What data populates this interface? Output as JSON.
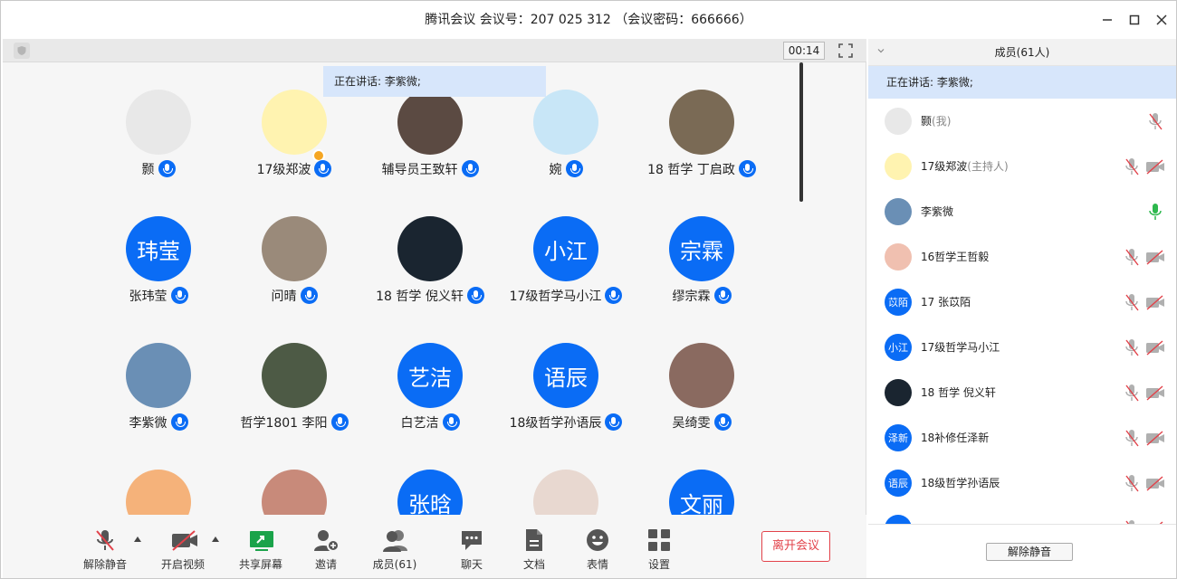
{
  "window": {
    "title": "腾讯会议 会议号：207 025 312 （会议密码：666666）",
    "minimize_icon": "minimize-icon",
    "maximize_icon": "maximize-icon",
    "close_icon": "close-icon"
  },
  "main": {
    "timer": "00:14",
    "speaking_banner": "正在讲话: 李紫微;",
    "tiles": [
      {
        "name": "颢",
        "avatar_text": "",
        "avatar_color": "#e8e8e8",
        "host": false
      },
      {
        "name": "17级郑波",
        "avatar_text": "",
        "avatar_color": "#fff3b0",
        "host": true
      },
      {
        "name": "辅导员王致轩",
        "avatar_text": "",
        "avatar_color": "#5b4a42",
        "host": false
      },
      {
        "name": "婉",
        "avatar_text": "",
        "avatar_color": "#c8e6f7",
        "host": false
      },
      {
        "name": "18 哲学 丁启政",
        "avatar_text": "",
        "avatar_color": "#7a6a55",
        "host": false
      },
      {
        "name": "张玮莹",
        "avatar_text": "玮莹",
        "avatar_color": "#0a6cf5",
        "host": false
      },
      {
        "name": "问晴",
        "avatar_text": "",
        "avatar_color": "#9a8a7a",
        "host": false
      },
      {
        "name": "18 哲学 倪义轩",
        "avatar_text": "",
        "avatar_color": "#1a2530",
        "host": false
      },
      {
        "name": "17级哲学马小江",
        "avatar_text": "小江",
        "avatar_color": "#0a6cf5",
        "host": false
      },
      {
        "name": "缪宗霖",
        "avatar_text": "宗霖",
        "avatar_color": "#0a6cf5",
        "host": false
      },
      {
        "name": "李紫微",
        "avatar_text": "",
        "avatar_color": "#6a8fb5",
        "host": false
      },
      {
        "name": "哲学1801 李阳",
        "avatar_text": "",
        "avatar_color": "#4d5a45",
        "host": false
      },
      {
        "name": "白艺洁",
        "avatar_text": "艺洁",
        "avatar_color": "#0a6cf5",
        "host": false
      },
      {
        "name": "18级哲学孙语辰",
        "avatar_text": "语辰",
        "avatar_color": "#0a6cf5",
        "host": false
      },
      {
        "name": "吴绮雯",
        "avatar_text": "",
        "avatar_color": "#8a6a60",
        "host": false
      },
      {
        "name": "",
        "avatar_text": "",
        "avatar_color": "#f5b27a",
        "host": false
      },
      {
        "name": "",
        "avatar_text": "",
        "avatar_color": "#c88a7a",
        "host": false
      },
      {
        "name": "",
        "avatar_text": "张晗",
        "avatar_color": "#0a6cf5",
        "host": false
      },
      {
        "name": "",
        "avatar_text": "",
        "avatar_color": "#e8d8d0",
        "host": false
      },
      {
        "name": "",
        "avatar_text": "文丽",
        "avatar_color": "#0a6cf5",
        "host": false
      }
    ],
    "toolbar": {
      "unmute": "解除静音",
      "start_video": "开启视频",
      "share_screen": "共享屏幕",
      "invite": "邀请",
      "members": "成员(61)",
      "chat": "聊天",
      "docs": "文档",
      "emoji": "表情",
      "settings": "设置",
      "leave": "离开会议"
    }
  },
  "sidebar": {
    "header": "成员(61人)",
    "speaking": "正在讲话: 李紫微;",
    "members": [
      {
        "name": "颢",
        "role": "(我)",
        "avatar_text": "",
        "avatar_color": "#e8e8e8",
        "mic": "muted",
        "cam": "none"
      },
      {
        "name": "17级郑波",
        "role": "(主持人)",
        "avatar_text": "",
        "avatar_color": "#fff3b0",
        "mic": "muted",
        "cam": "off"
      },
      {
        "name": "李紫微",
        "role": "",
        "avatar_text": "",
        "avatar_color": "#6a8fb5",
        "mic": "active",
        "cam": "none"
      },
      {
        "name": "16哲学王哲毅",
        "role": "",
        "avatar_text": "",
        "avatar_color": "#f0c0b0",
        "mic": "muted",
        "cam": "off"
      },
      {
        "name": "17 张苡陌",
        "role": "",
        "avatar_text": "苡陌",
        "avatar_color": "#0a6cf5",
        "mic": "muted",
        "cam": "off"
      },
      {
        "name": "17级哲学马小江",
        "role": "",
        "avatar_text": "小江",
        "avatar_color": "#0a6cf5",
        "mic": "muted",
        "cam": "off"
      },
      {
        "name": "18 哲学 倪义轩",
        "role": "",
        "avatar_text": "",
        "avatar_color": "#1a2530",
        "mic": "muted",
        "cam": "off"
      },
      {
        "name": "18补修任泽新",
        "role": "",
        "avatar_text": "泽新",
        "avatar_color": "#0a6cf5",
        "mic": "muted",
        "cam": "off"
      },
      {
        "name": "18级哲学孙语辰",
        "role": "",
        "avatar_text": "语辰",
        "avatar_color": "#0a6cf5",
        "mic": "muted",
        "cam": "off"
      },
      {
        "name": "",
        "role": "",
        "avatar_text": "",
        "avatar_color": "#0a6cf5",
        "mic": "muted",
        "cam": "off"
      }
    ],
    "unmute_all": "解除静音"
  }
}
